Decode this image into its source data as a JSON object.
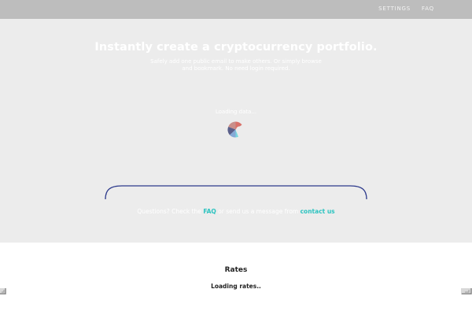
{
  "nav": {
    "settings_label": "SETTINGS",
    "faq_label": "FAQ"
  },
  "hero": {
    "title": "Instantly create a cryptocurrency portfolio.",
    "subtitle": "Safely add one public email to make others. Or simply browse and bookmark. No need login required.",
    "loading_label": "Loading data...",
    "question_prefix": "Questions? Check the",
    "faq_link": "FAQ",
    "question_middle": "or send us a message from",
    "contact_link": "contact us"
  },
  "rates": {
    "title": "Rates",
    "loading": "Loading rates.."
  },
  "colors": {
    "topbar": "#bdbdbd",
    "hero_bg": "#ececec",
    "link": "#2bc3c0",
    "arc": "#2d3a8c",
    "spinner_red": "#d9726a",
    "spinner_blue": "#86a9d6",
    "spinner_cyan": "#7ad8de",
    "spinner_dark": "#5a5f8a"
  },
  "icons": {
    "spinner": "loading-spinner-icon",
    "left_corner": "resize-corner-icon",
    "right_corner": "resize-corner-icon"
  }
}
